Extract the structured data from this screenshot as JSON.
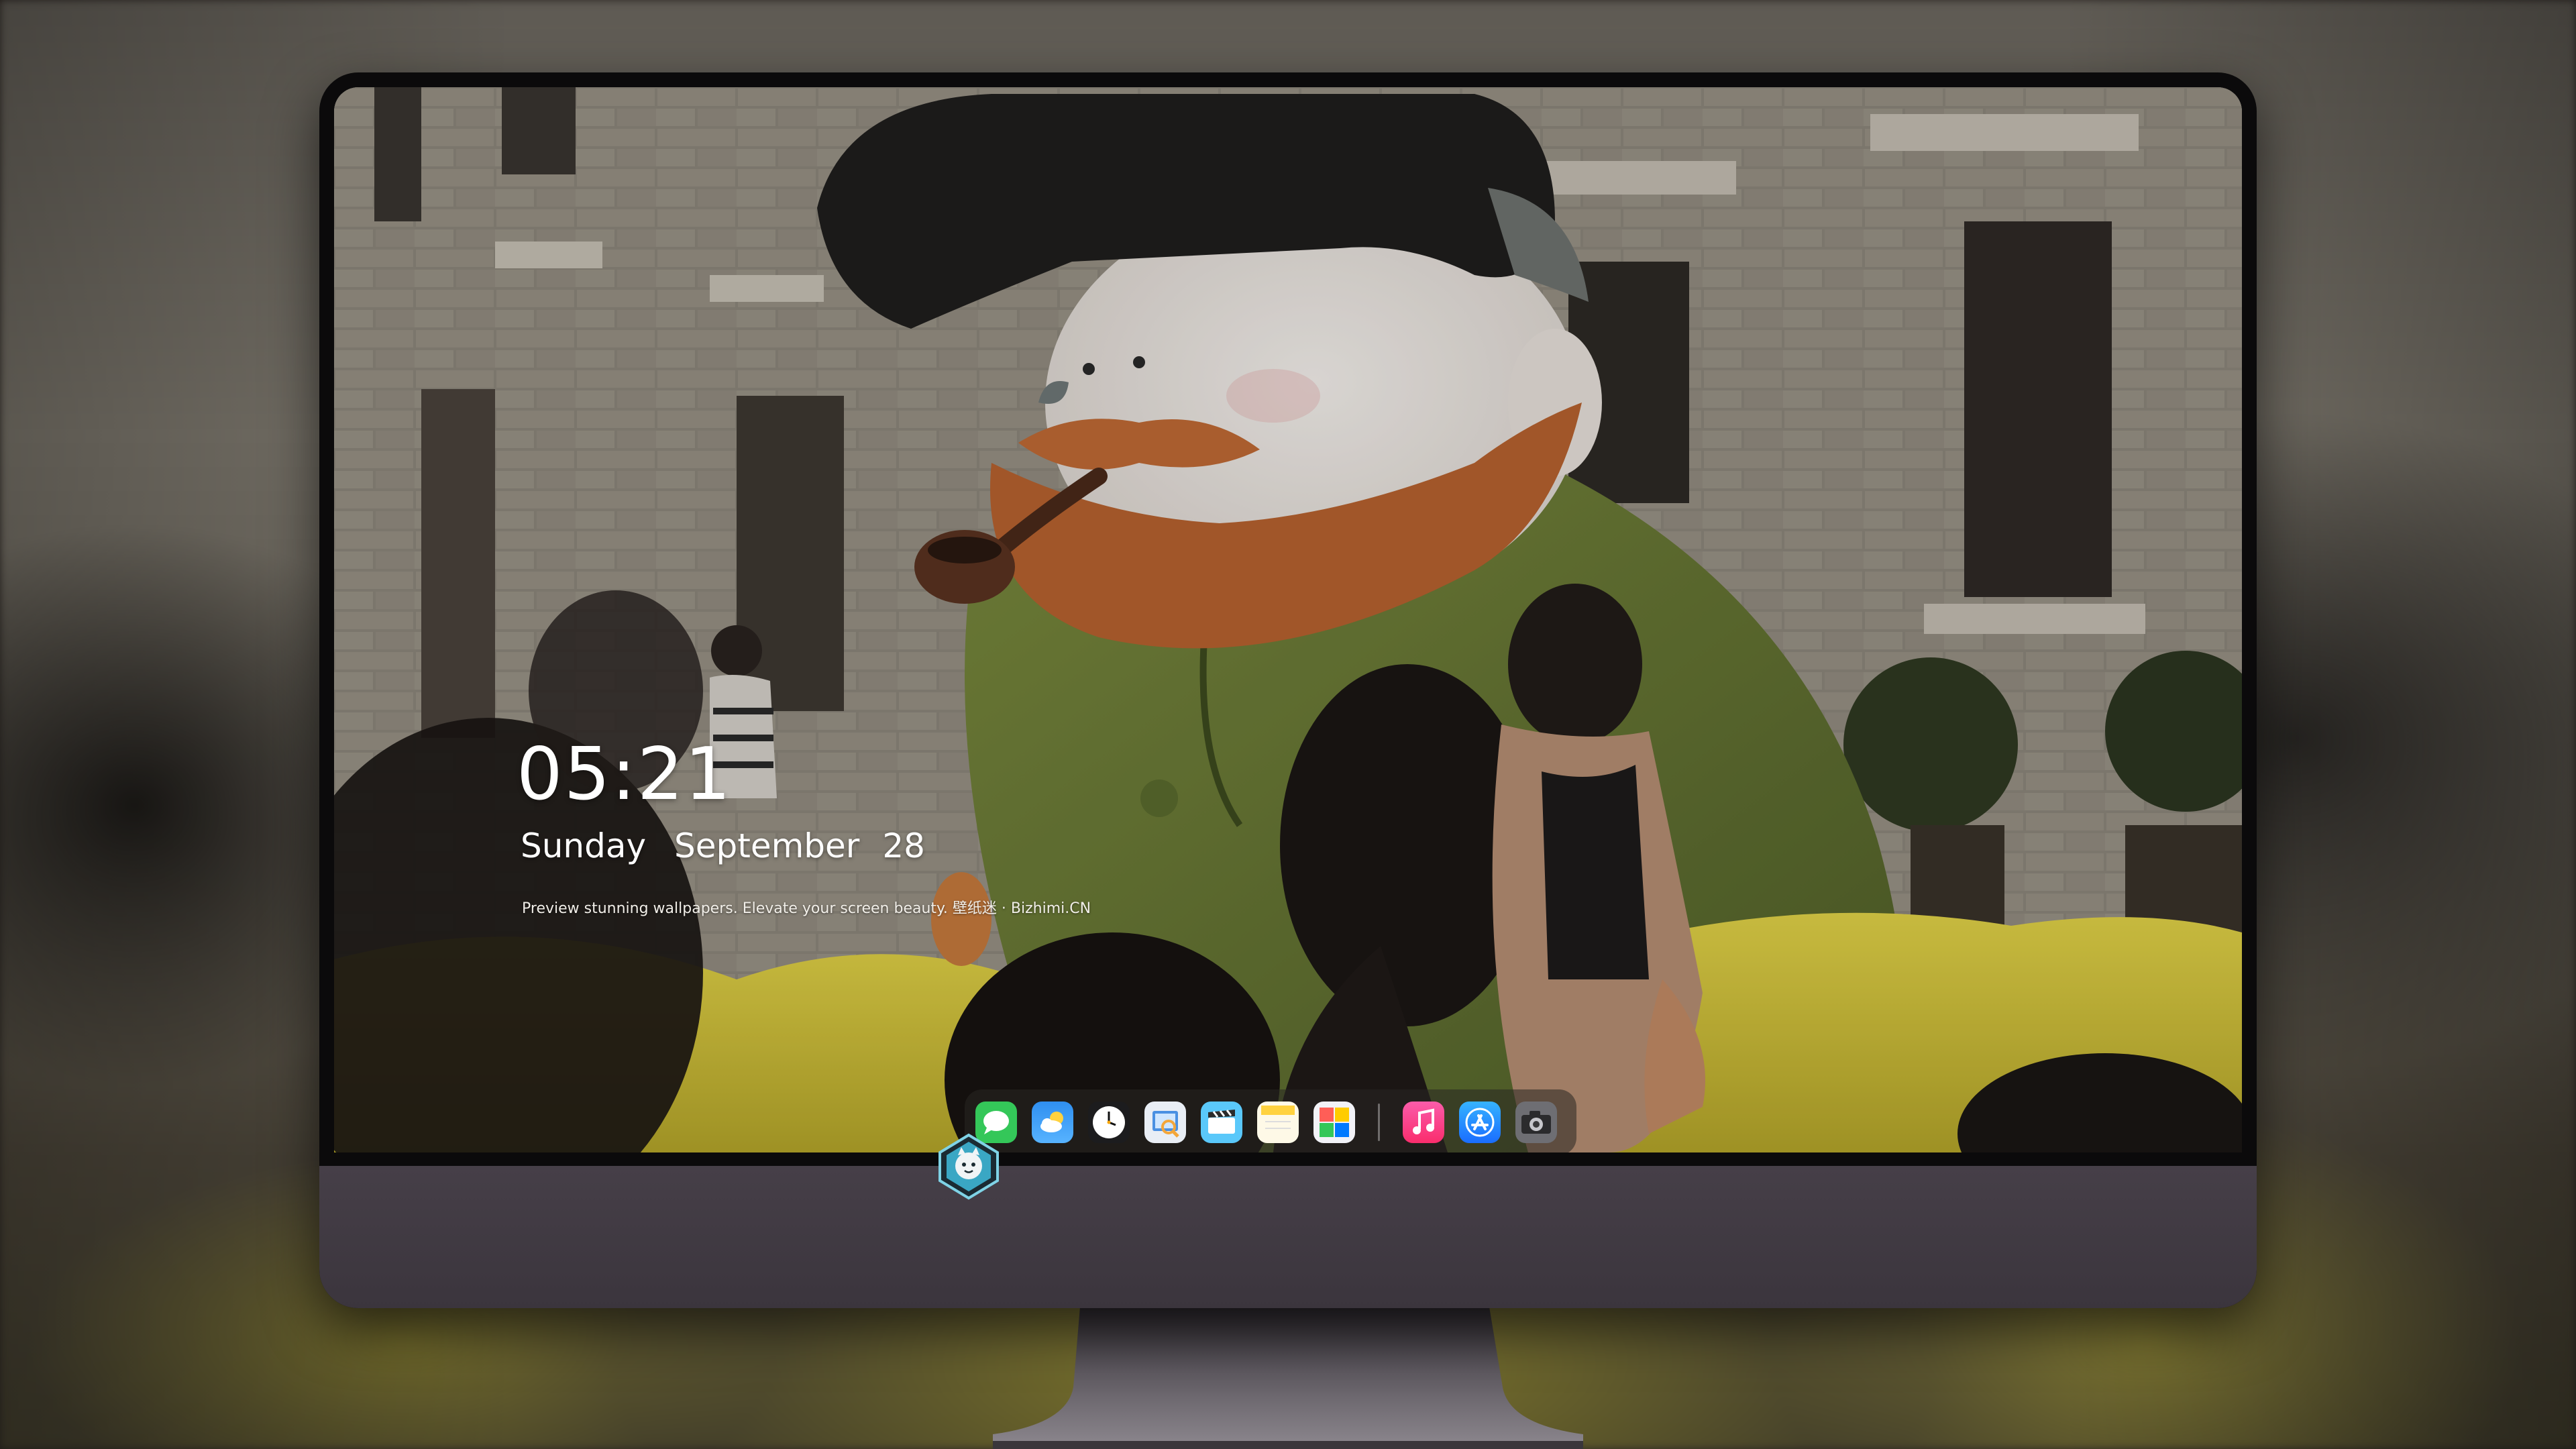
{
  "lock_screen": {
    "time": "05:21",
    "weekday": "Sunday",
    "month": "September",
    "day": "28",
    "tagline": "Preview stunning wallpapers. Elevate your screen beauty. 壁纸迷 · Bizhimi.CN"
  },
  "dock": {
    "apps": [
      {
        "name": "messages-icon",
        "color": "#34c759"
      },
      {
        "name": "weather-icon",
        "color": "#2f8ff0"
      },
      {
        "name": "clock-icon",
        "color": "#1c1c1e"
      },
      {
        "name": "preview-icon",
        "color": "#e9eef5"
      },
      {
        "name": "clips-icon",
        "color": "#5ac8fa"
      },
      {
        "name": "notes-icon",
        "color": "#fef9e7"
      },
      {
        "name": "photo-booth-icon",
        "color": "#f2f2f7"
      },
      {
        "name": "music-icon",
        "color": "#fa2d6d"
      },
      {
        "name": "app-store-icon",
        "color": "#1a8cff"
      },
      {
        "name": "camera-icon",
        "color": "#6e6e73"
      }
    ]
  },
  "colors": {
    "bezel": "#0b0a0b",
    "chin": "#413a43",
    "stand": "#6f6a70"
  }
}
